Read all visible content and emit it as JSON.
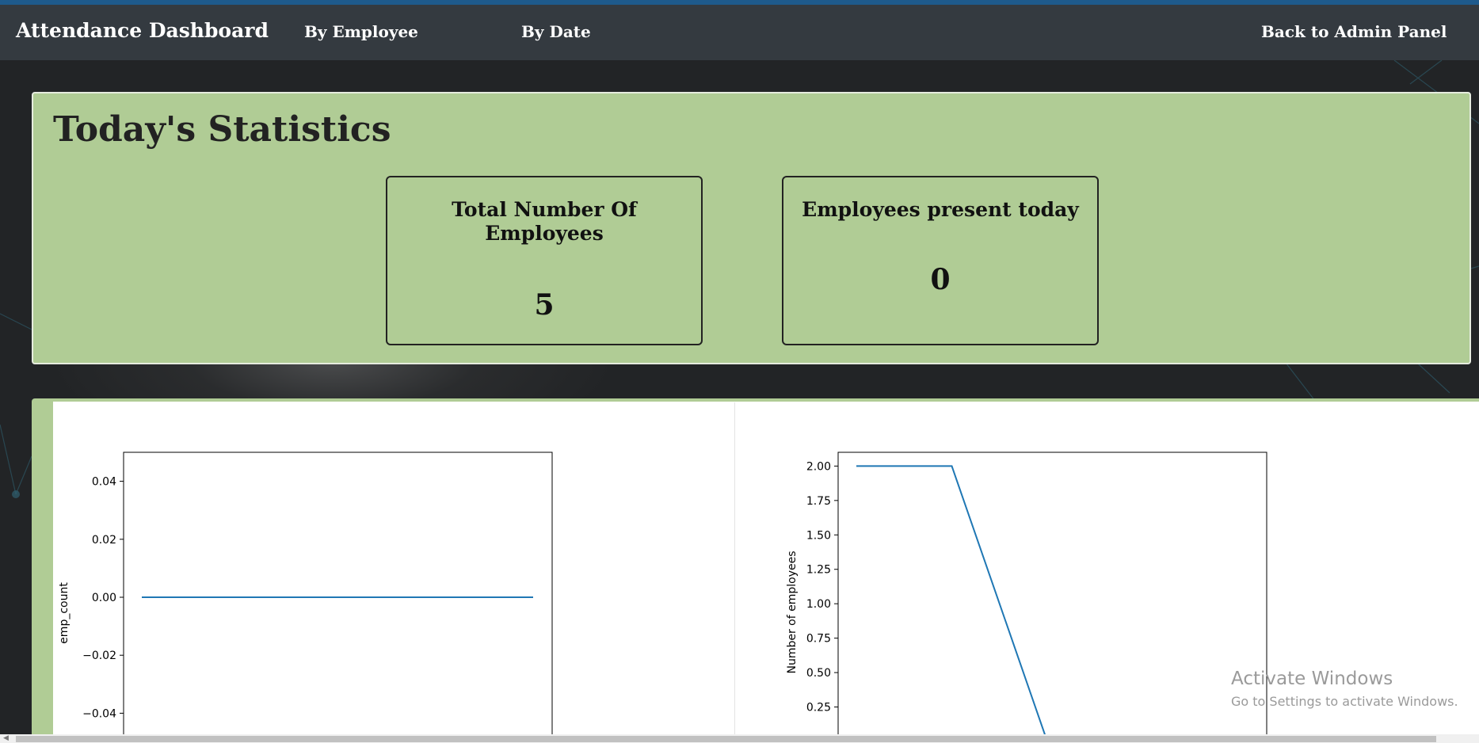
{
  "navbar": {
    "brand": "Attendance Dashboard",
    "links": [
      "By Employee",
      "By Date"
    ],
    "back_label": "Back to Admin Panel"
  },
  "stats": {
    "title": "Today's Statistics",
    "cards": [
      {
        "title_line1": "Total Number Of",
        "title_line2": "Employees",
        "value": "5"
      },
      {
        "title_line1": "Employees present today",
        "title_line2": "",
        "value": "0"
      }
    ]
  },
  "chart_data": [
    {
      "type": "line",
      "ylabel": "emp_count",
      "xlabel": "",
      "title": "",
      "yticks": [
        "0.04",
        "0.02",
        "0.00",
        "−0.02",
        "−0.04"
      ],
      "ylim": [
        -0.05,
        0.05
      ],
      "series": [
        {
          "values": [
            0,
            0
          ]
        }
      ]
    },
    {
      "type": "line",
      "ylabel": "Number of employees",
      "xlabel": "",
      "title": "",
      "yticks": [
        "2.00",
        "1.75",
        "1.50",
        "1.25",
        "1.00",
        "0.75",
        "0.50",
        "0.25"
      ],
      "ylim": [
        0,
        2.1
      ],
      "series": [
        {
          "values": [
            2,
            2,
            0
          ]
        }
      ]
    }
  ],
  "watermark": {
    "line1": "Activate Windows",
    "line2": "Go to Settings to activate Windows."
  },
  "colors": {
    "navbar": "#343a40",
    "panel_green": "#b0cc95",
    "line_blue": "#1f77b4",
    "top_stripe": "#1e5a8c"
  }
}
